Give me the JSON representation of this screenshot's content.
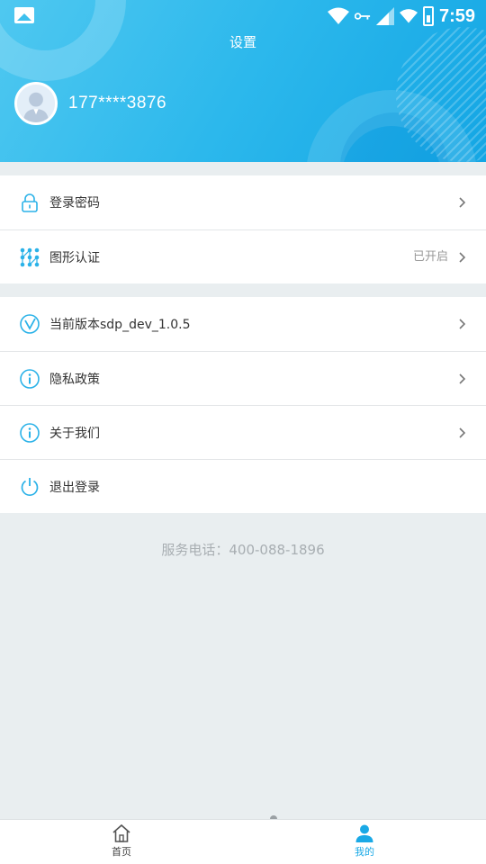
{
  "status_bar": {
    "time": "7:59",
    "icons": [
      "image-icon",
      "wifi-icon",
      "key-icon",
      "signal-icon",
      "battery-icon"
    ]
  },
  "header": {
    "title": "设置",
    "phone": "177****3876",
    "avatar_icon": "user-avatar-icon"
  },
  "security": {
    "items": [
      {
        "label": "登录密码",
        "icon": "lock-icon"
      },
      {
        "label": "图形认证",
        "icon": "pattern-grid-icon",
        "status": "已开启"
      }
    ]
  },
  "info": {
    "items": [
      {
        "label": "当前版本sdp_dev_1.0.5",
        "icon": "version-v-icon"
      },
      {
        "label": "隐私政策",
        "icon": "info-circle-icon"
      },
      {
        "label": "关于我们",
        "icon": "info-circle-icon"
      },
      {
        "label": "退出登录",
        "icon": "power-icon"
      }
    ]
  },
  "service_phone": "服务电话：400-088-1896",
  "bottom_nav": {
    "items": [
      {
        "label": "首页",
        "icon": "home-icon",
        "active": false
      },
      {
        "label": "我的",
        "icon": "person-icon",
        "active": true
      }
    ]
  },
  "colors": {
    "accent": "#1aa9e6",
    "header_gradient_start": "#4fc8f0",
    "header_gradient_end": "#14a6e4",
    "page_bg": "#e9eef0"
  }
}
